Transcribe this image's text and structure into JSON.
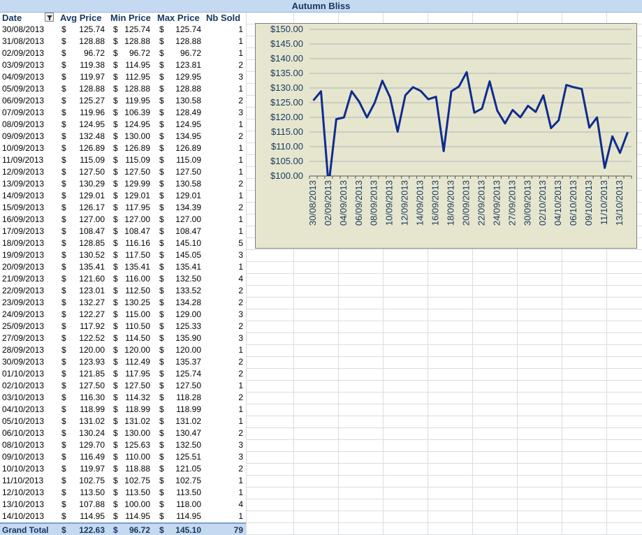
{
  "sheet": {
    "title": "Autumn Bliss",
    "headers": {
      "date": "Date",
      "avg": "Avg Price",
      "min": "Min Price",
      "max": "Max Price",
      "nb": "Nb Sold"
    },
    "currency": "$",
    "rows": [
      {
        "date": "30/08/2013",
        "avg": "125.74",
        "min": "125.74",
        "max": "125.74",
        "nb": "1"
      },
      {
        "date": "31/08/2013",
        "avg": "128.88",
        "min": "128.88",
        "max": "128.88",
        "nb": "1"
      },
      {
        "date": "02/09/2013",
        "avg": "96.72",
        "min": "96.72",
        "max": "96.72",
        "nb": "1"
      },
      {
        "date": "03/09/2013",
        "avg": "119.38",
        "min": "114.95",
        "max": "123.81",
        "nb": "2"
      },
      {
        "date": "04/09/2013",
        "avg": "119.97",
        "min": "112.95",
        "max": "129.95",
        "nb": "3"
      },
      {
        "date": "05/09/2013",
        "avg": "128.88",
        "min": "128.88",
        "max": "128.88",
        "nb": "1"
      },
      {
        "date": "06/09/2013",
        "avg": "125.27",
        "min": "119.95",
        "max": "130.58",
        "nb": "2"
      },
      {
        "date": "07/09/2013",
        "avg": "119.96",
        "min": "106.39",
        "max": "128.49",
        "nb": "3"
      },
      {
        "date": "08/09/2013",
        "avg": "124.95",
        "min": "124.95",
        "max": "124.95",
        "nb": "1"
      },
      {
        "date": "09/09/2013",
        "avg": "132.48",
        "min": "130.00",
        "max": "134.95",
        "nb": "2"
      },
      {
        "date": "10/09/2013",
        "avg": "126.89",
        "min": "126.89",
        "max": "126.89",
        "nb": "1"
      },
      {
        "date": "11/09/2013",
        "avg": "115.09",
        "min": "115.09",
        "max": "115.09",
        "nb": "1"
      },
      {
        "date": "12/09/2013",
        "avg": "127.50",
        "min": "127.50",
        "max": "127.50",
        "nb": "1"
      },
      {
        "date": "13/09/2013",
        "avg": "130.29",
        "min": "129.99",
        "max": "130.58",
        "nb": "2"
      },
      {
        "date": "14/09/2013",
        "avg": "129.01",
        "min": "129.01",
        "max": "129.01",
        "nb": "1"
      },
      {
        "date": "15/09/2013",
        "avg": "126.17",
        "min": "117.95",
        "max": "134.39",
        "nb": "2"
      },
      {
        "date": "16/09/2013",
        "avg": "127.00",
        "min": "127.00",
        "max": "127.00",
        "nb": "1"
      },
      {
        "date": "17/09/2013",
        "avg": "108.47",
        "min": "108.47",
        "max": "108.47",
        "nb": "1"
      },
      {
        "date": "18/09/2013",
        "avg": "128.85",
        "min": "116.16",
        "max": "145.10",
        "nb": "5"
      },
      {
        "date": "19/09/2013",
        "avg": "130.52",
        "min": "117.50",
        "max": "145.05",
        "nb": "3"
      },
      {
        "date": "20/09/2013",
        "avg": "135.41",
        "min": "135.41",
        "max": "135.41",
        "nb": "1"
      },
      {
        "date": "21/09/2013",
        "avg": "121.60",
        "min": "116.00",
        "max": "132.50",
        "nb": "4"
      },
      {
        "date": "22/09/2013",
        "avg": "123.01",
        "min": "112.50",
        "max": "133.52",
        "nb": "2"
      },
      {
        "date": "23/09/2013",
        "avg": "132.27",
        "min": "130.25",
        "max": "134.28",
        "nb": "2"
      },
      {
        "date": "24/09/2013",
        "avg": "122.27",
        "min": "115.00",
        "max": "129.00",
        "nb": "3"
      },
      {
        "date": "25/09/2013",
        "avg": "117.92",
        "min": "110.50",
        "max": "125.33",
        "nb": "2"
      },
      {
        "date": "27/09/2013",
        "avg": "122.52",
        "min": "114.50",
        "max": "135.90",
        "nb": "3"
      },
      {
        "date": "28/09/2013",
        "avg": "120.00",
        "min": "120.00",
        "max": "120.00",
        "nb": "1"
      },
      {
        "date": "30/09/2013",
        "avg": "123.93",
        "min": "112.49",
        "max": "135.37",
        "nb": "2"
      },
      {
        "date": "01/10/2013",
        "avg": "121.85",
        "min": "117.95",
        "max": "125.74",
        "nb": "2"
      },
      {
        "date": "02/10/2013",
        "avg": "127.50",
        "min": "127.50",
        "max": "127.50",
        "nb": "1"
      },
      {
        "date": "03/10/2013",
        "avg": "116.30",
        "min": "114.32",
        "max": "118.28",
        "nb": "2"
      },
      {
        "date": "04/10/2013",
        "avg": "118.99",
        "min": "118.99",
        "max": "118.99",
        "nb": "1"
      },
      {
        "date": "05/10/2013",
        "avg": "131.02",
        "min": "131.02",
        "max": "131.02",
        "nb": "1"
      },
      {
        "date": "06/10/2013",
        "avg": "130.24",
        "min": "130.00",
        "max": "130.47",
        "nb": "2"
      },
      {
        "date": "08/10/2013",
        "avg": "129.70",
        "min": "125.63",
        "max": "132.50",
        "nb": "3"
      },
      {
        "date": "09/10/2013",
        "avg": "116.49",
        "min": "110.00",
        "max": "125.51",
        "nb": "3"
      },
      {
        "date": "10/10/2013",
        "avg": "119.97",
        "min": "118.88",
        "max": "121.05",
        "nb": "2"
      },
      {
        "date": "11/10/2013",
        "avg": "102.75",
        "min": "102.75",
        "max": "102.75",
        "nb": "1"
      },
      {
        "date": "12/10/2013",
        "avg": "113.50",
        "min": "113.50",
        "max": "113.50",
        "nb": "1"
      },
      {
        "date": "13/10/2013",
        "avg": "107.88",
        "min": "100.00",
        "max": "118.00",
        "nb": "4"
      },
      {
        "date": "14/10/2013",
        "avg": "114.95",
        "min": "114.95",
        "max": "114.95",
        "nb": "1"
      }
    ],
    "total": {
      "label": "Grand Total",
      "avg": "122.63",
      "min": "96.72",
      "max": "145.10",
      "nb": "79"
    }
  },
  "chart_data": {
    "type": "line",
    "title": "",
    "xlabel": "",
    "ylabel": "",
    "ylim": [
      100,
      150
    ],
    "y_ticks": [
      "$100.00",
      "$105.00",
      "$110.00",
      "$115.00",
      "$120.00",
      "$125.00",
      "$130.00",
      "$135.00",
      "$140.00",
      "$145.00",
      "$150.00"
    ],
    "x_tick_labels": [
      "30/08/2013",
      "02/09/2013",
      "04/09/2013",
      "06/09/2013",
      "08/09/2013",
      "10/09/2013",
      "12/09/2013",
      "14/09/2013",
      "16/09/2013",
      "18/09/2013",
      "20/09/2013",
      "22/09/2013",
      "24/09/2013",
      "27/09/2013",
      "30/09/2013",
      "02/10/2013",
      "04/10/2013",
      "06/10/2013",
      "09/10/2013",
      "11/10/2013",
      "13/10/2013"
    ],
    "categories": [
      "30/08/2013",
      "31/08/2013",
      "02/09/2013",
      "03/09/2013",
      "04/09/2013",
      "05/09/2013",
      "06/09/2013",
      "07/09/2013",
      "08/09/2013",
      "09/09/2013",
      "10/09/2013",
      "11/09/2013",
      "12/09/2013",
      "13/09/2013",
      "14/09/2013",
      "15/09/2013",
      "16/09/2013",
      "17/09/2013",
      "18/09/2013",
      "19/09/2013",
      "20/09/2013",
      "21/09/2013",
      "22/09/2013",
      "23/09/2013",
      "24/09/2013",
      "25/09/2013",
      "27/09/2013",
      "28/09/2013",
      "30/09/2013",
      "01/10/2013",
      "02/10/2013",
      "03/10/2013",
      "04/10/2013",
      "05/10/2013",
      "06/10/2013",
      "08/10/2013",
      "09/10/2013",
      "10/10/2013",
      "11/10/2013",
      "12/10/2013",
      "13/10/2013",
      "14/10/2013"
    ],
    "values": [
      125.74,
      128.88,
      96.72,
      119.38,
      119.97,
      128.88,
      125.27,
      119.96,
      124.95,
      132.48,
      126.89,
      115.09,
      127.5,
      130.29,
      129.01,
      126.17,
      127.0,
      108.47,
      128.85,
      130.52,
      135.41,
      121.6,
      123.01,
      132.27,
      122.27,
      117.92,
      122.52,
      120.0,
      123.93,
      121.85,
      127.5,
      116.3,
      118.99,
      131.02,
      130.24,
      129.7,
      116.49,
      119.97,
      102.75,
      113.5,
      107.88,
      114.95
    ],
    "line_color": "#0f2c8c",
    "plot_bg": "#e6e6cf",
    "grid": true,
    "legend": "none"
  }
}
